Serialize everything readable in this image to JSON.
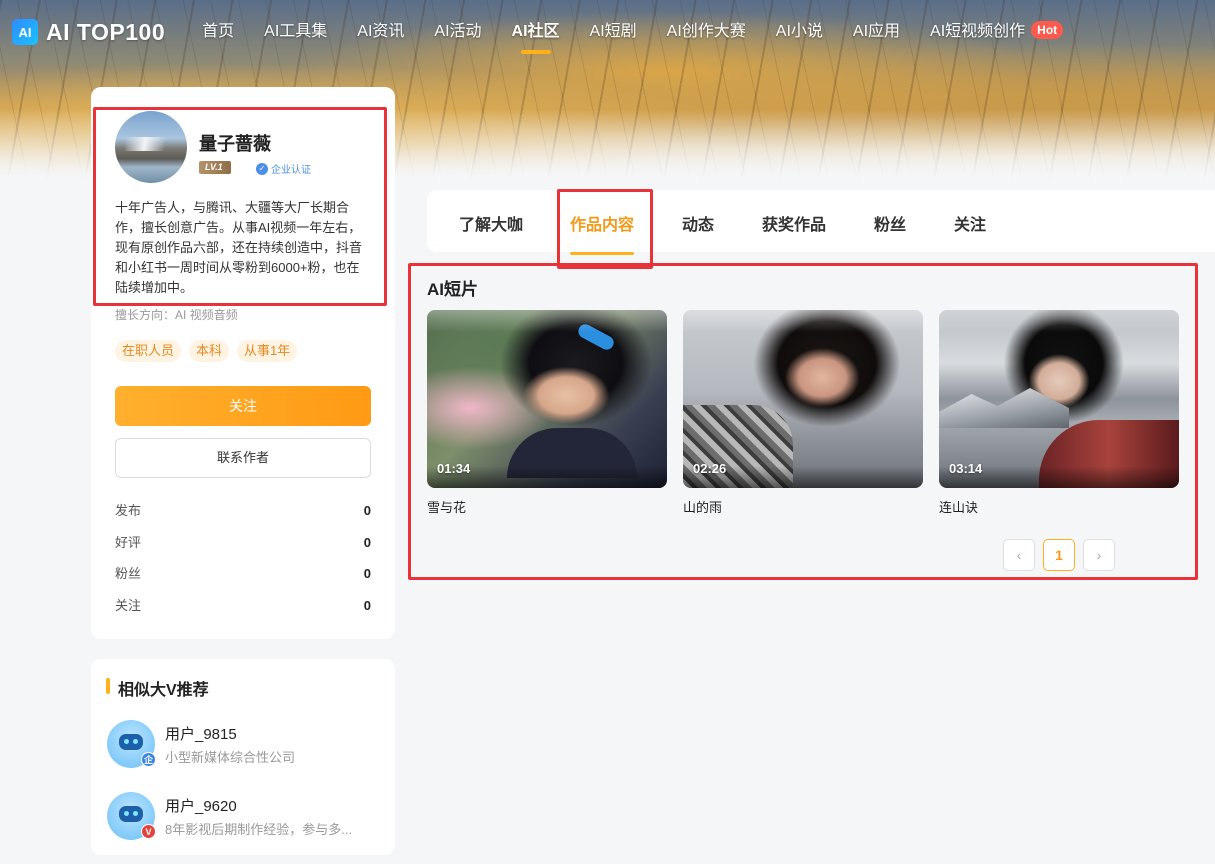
{
  "nav": {
    "brand": "AI TOP100",
    "logo_text": "AI",
    "items": [
      {
        "label": "首页"
      },
      {
        "label": "AI工具集"
      },
      {
        "label": "AI资讯"
      },
      {
        "label": "AI活动"
      },
      {
        "label": "AI社区",
        "active": true
      },
      {
        "label": "AI短剧"
      },
      {
        "label": "AI创作大赛"
      },
      {
        "label": "AI小说"
      },
      {
        "label": "AI应用"
      },
      {
        "label": "AI短视频创作"
      }
    ],
    "hot_badge": "Hot"
  },
  "profile": {
    "name": "量子蔷薇",
    "level": "LV.1",
    "verify_label": "企业认证",
    "bio": "十年广告人，与腾讯、大疆等大厂长期合作，擅长创意广告。从事AI视频一年左右，现有原创作品六部，还在持续创造中，抖音和小红书一周时间从零粉到6000+粉，也在陆续增加中。",
    "specialty": "擅长方向：AI 视频音频",
    "tags": [
      "在职人员",
      "本科",
      "从事1年"
    ],
    "follow_button": "关注",
    "contact_button": "联系作者",
    "stats": [
      {
        "label": "发布",
        "value": "0"
      },
      {
        "label": "好评",
        "value": "0"
      },
      {
        "label": "粉丝",
        "value": "0"
      },
      {
        "label": "关注",
        "value": "0"
      }
    ]
  },
  "recommend": {
    "title": "相似大V推荐",
    "items": [
      {
        "name": "用户_9815",
        "desc": "小型新媒体综合性公司",
        "badge": "企"
      },
      {
        "name": "用户_9620",
        "desc": "8年影视后期制作经验，参与多...",
        "badge": "V"
      }
    ]
  },
  "tabs": [
    {
      "label": "了解大咖"
    },
    {
      "label": "作品内容",
      "active": true
    },
    {
      "label": "动态"
    },
    {
      "label": "获奖作品"
    },
    {
      "label": "粉丝"
    },
    {
      "label": "关注"
    }
  ],
  "works": {
    "section_title": "AI短片",
    "videos": [
      {
        "title": "雪与花",
        "duration": "01:34"
      },
      {
        "title": "山的雨",
        "duration": "02:26"
      },
      {
        "title": "连山诀",
        "duration": "03:14"
      }
    ],
    "pagination": {
      "prev": "‹",
      "current": "1",
      "next": "›"
    }
  },
  "colors": {
    "accent": "#ffb11b",
    "active_tab": "#f39a1a",
    "highlight_frame": "#e8333a"
  }
}
